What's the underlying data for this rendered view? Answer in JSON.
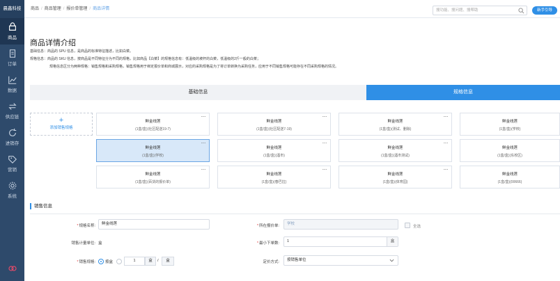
{
  "sidebar": {
    "brand": "晨鑫科技",
    "items": [
      {
        "label": "商品",
        "icon": "box-icon",
        "active": true
      },
      {
        "label": "订单",
        "icon": "document-icon",
        "active": false
      },
      {
        "label": "数据",
        "icon": "line-chart-icon",
        "active": false
      },
      {
        "label": "供应链",
        "icon": "swap-icon",
        "active": false
      },
      {
        "label": "进销存",
        "icon": "cycle-icon",
        "active": false
      },
      {
        "label": "营销",
        "icon": "tag-icon",
        "active": false
      },
      {
        "label": "系统",
        "icon": "gear-icon",
        "active": false
      }
    ]
  },
  "topbar": {
    "breadcrumb": [
      "商品",
      "商品管理",
      "报价单管理",
      "商品详情"
    ],
    "search_placeholder": "搜功能、搜问题、搜帮助",
    "guide_label": "新手引导"
  },
  "page": {
    "title": "商品详情介绍",
    "desc1": "基础信息：商品的 SPU 信息，是商品的标准特征描述，比如白菜。",
    "desc2": "规格信息：商品的 SKU 信息，按商品是不同特征分为不同的规格，比如商品【白菜】的规格信息有：低温级的坡杆的白菜，低温级的2斤一般的白菜；",
    "desc3": "规格信息区分为两种规格：销售规格和采购规格，销售规格用于绑定报价单和商城展示，对应的采购规格是为了将订单转换为采购任务，应用于不同销售规格可能存在不同采购规格的情况。"
  },
  "tabs": {
    "basic": "基础信息",
    "spec": "规格信息"
  },
  "add_spec_label": "添加销售规格",
  "specs": [
    {
      "name": "鲜金线莲",
      "sub": "(1盒/盒)(社区配送19-7)",
      "selected": false
    },
    {
      "name": "鲜金线莲",
      "sub": "(1盒/盒)(社区配送7-19)",
      "selected": false
    },
    {
      "name": "鲜金线莲",
      "sub": "(1盒/盒)(测试、删除)",
      "selected": false
    },
    {
      "name": "鲜金线莲",
      "sub": "(1盒/盒)(学校)",
      "selected": false
    },
    {
      "name": "鲜金线莲",
      "sub": "(1盒/盒)(学校)",
      "selected": true
    },
    {
      "name": "鲜金线莲",
      "sub": "(1盒/盒)(酒市)",
      "selected": false
    },
    {
      "name": "鲜金线莲",
      "sub": "(1盒/盒)(酒市测试)",
      "selected": false
    },
    {
      "name": "鲜金线莲",
      "sub": "(1盒/盒)(东校区)",
      "selected": false
    },
    {
      "name": "鲜金线莲",
      "sub": "(1盒/盒)(百货的报价单)",
      "selected": false
    },
    {
      "name": "鲜金线莲",
      "sub": "(1盒/盒)(春巴拉)",
      "selected": false
    },
    {
      "name": "鲜金线莲",
      "sub": "(1盒/盒)(体育园)",
      "selected": false
    },
    {
      "name": "鲜金线莲",
      "sub": "(1盒/盒)(00666)",
      "selected": false
    }
  ],
  "more_glyph": "···",
  "sales": {
    "section_title": "销售信息",
    "spec_name_label": "规格名称:",
    "spec_name_value": "鲜金线莲",
    "quote_label": "所在报价单:",
    "quote_value": "学校",
    "select_all": "全选",
    "unit_label": "销售计量单位:",
    "unit_value": "盒",
    "min_order_label": "最小下单数:",
    "min_order_value": "1",
    "min_order_unit": "盒",
    "sale_spec_label": "销售规格:",
    "by_box": "按盒",
    "qty": "1",
    "qty_unit": "盒",
    "slash": "/",
    "box_unit": "盒",
    "pricing_label": "定价方式:",
    "pricing_value": "按销售单位"
  },
  "colors": {
    "primary": "#2f8fe6",
    "sidebar": "#2e4a6b"
  }
}
